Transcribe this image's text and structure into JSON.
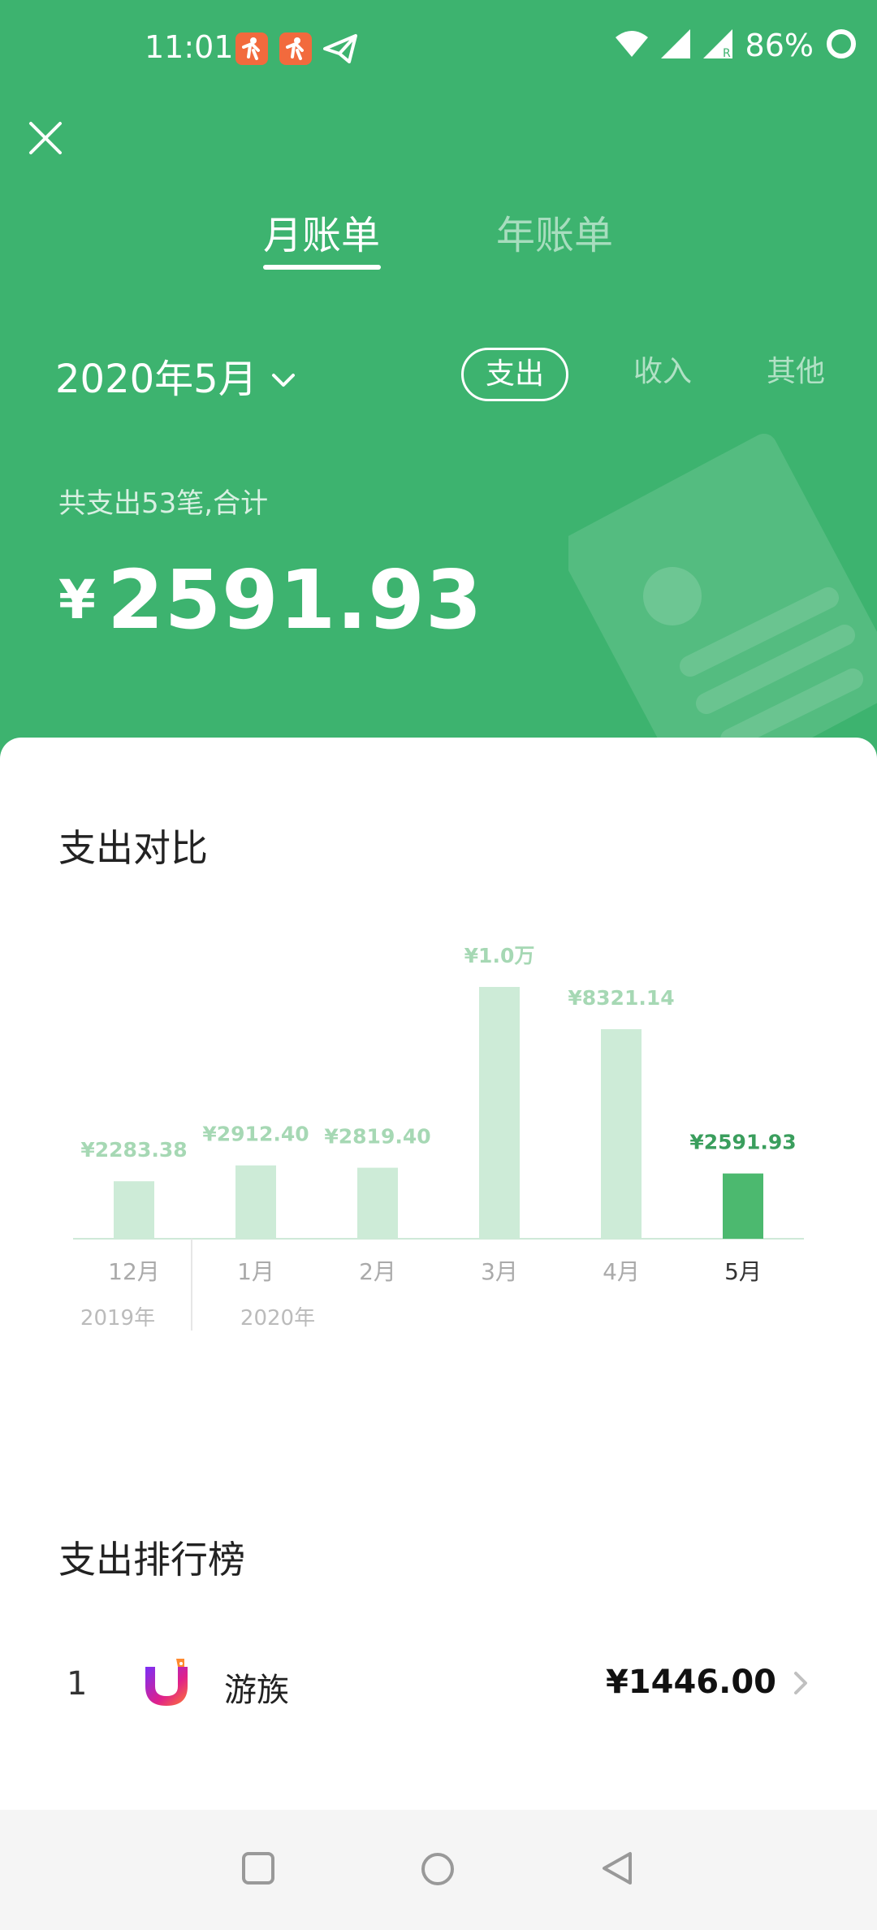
{
  "status_bar": {
    "time": "11:01",
    "battery": "86%"
  },
  "tabs": [
    {
      "label": "月账单",
      "active": true
    },
    {
      "label": "年账单",
      "active": false
    }
  ],
  "filters": {
    "date": "2020年5月",
    "types": [
      {
        "label": "支出",
        "active": true
      },
      {
        "label": "收入",
        "active": false
      },
      {
        "label": "其他",
        "active": false
      }
    ]
  },
  "summary": {
    "text": "共支出53笔,合计",
    "currency": "¥",
    "total": "2591.93"
  },
  "chart_section": {
    "title": "支出对比"
  },
  "chart_data": {
    "type": "bar",
    "categories": [
      "12月",
      "1月",
      "2月",
      "3月",
      "4月",
      "5月"
    ],
    "values": [
      2283.38,
      2912.4,
      2819.4,
      10000,
      8321.14,
      2591.93
    ],
    "value_labels": [
      "¥2283.38",
      "¥2912.40",
      "¥2819.40",
      "¥1.0万",
      "¥8321.14",
      "¥2591.93"
    ],
    "year_labels": [
      "2019年",
      "2020年"
    ],
    "highlighted_index": 5,
    "colors": {
      "bar": "#cdebd7",
      "highlight": "#4cb96f",
      "label": "#a6d8b4",
      "highlight_label": "#3a9e5d"
    }
  },
  "ranking": {
    "title": "支出排行榜",
    "items": [
      {
        "rank": "1",
        "name": "游族",
        "amount": "¥1446.00"
      }
    ]
  },
  "colors": {
    "brand": "#3db36f",
    "card": "#ffffff"
  }
}
